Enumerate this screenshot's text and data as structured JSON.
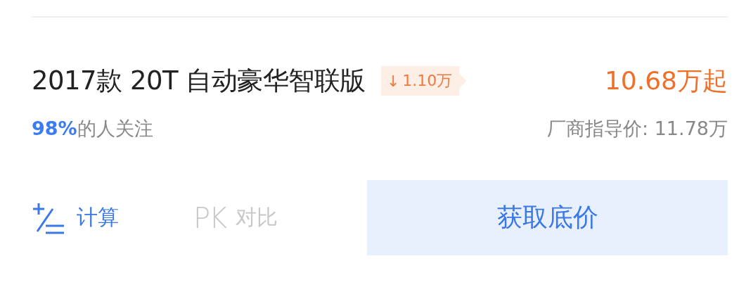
{
  "model": {
    "name": "2017款 20T 自动豪华智联版",
    "drop": {
      "arrow": "↓",
      "amount": "1.10万"
    },
    "price": "10.68万起"
  },
  "attention": "**98%**的人关注",
  "guide_price": "厂商指导价: 11.78万",
  "actions": [
    {
      "kind": "calc",
      "label": "计算",
      "disabled": false
    },
    {
      "kind": "pk",
      "icon_text": "PK",
      "label": "对比",
      "disabled": true
    }
  ],
  "cta": "获取底价"
}
